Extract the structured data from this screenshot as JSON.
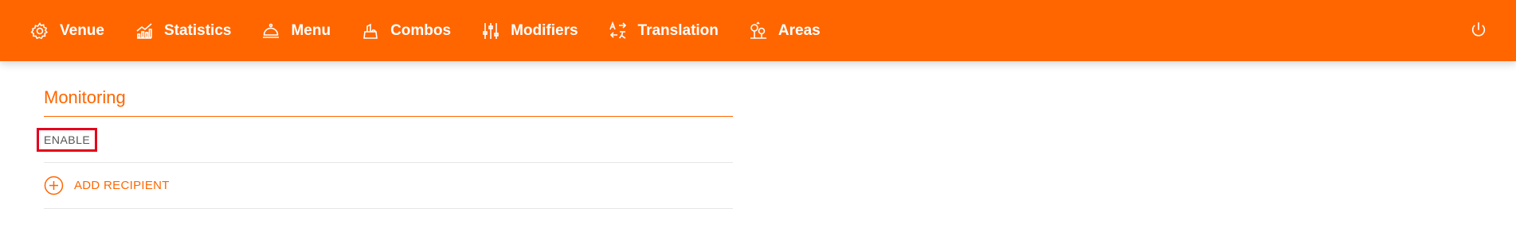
{
  "colors": {
    "brand": "#ff6600",
    "highlight": "#e3001b",
    "divider": "#e6e6e6"
  },
  "nav": {
    "items": [
      {
        "label": "Venue",
        "icon": "gear-icon"
      },
      {
        "label": "Statistics",
        "icon": "chart-icon"
      },
      {
        "label": "Menu",
        "icon": "cloche-icon"
      },
      {
        "label": "Combos",
        "icon": "combo-icon"
      },
      {
        "label": "Modifiers",
        "icon": "sliders-icon"
      },
      {
        "label": "Translation",
        "icon": "translate-icon"
      },
      {
        "label": "Areas",
        "icon": "trees-icon"
      }
    ],
    "power_icon": "power-icon"
  },
  "section": {
    "title": "Monitoring",
    "enable_label": "ENABLE",
    "add_recipient_label": "ADD RECIPIENT",
    "add_icon": "plus-circle-icon"
  }
}
